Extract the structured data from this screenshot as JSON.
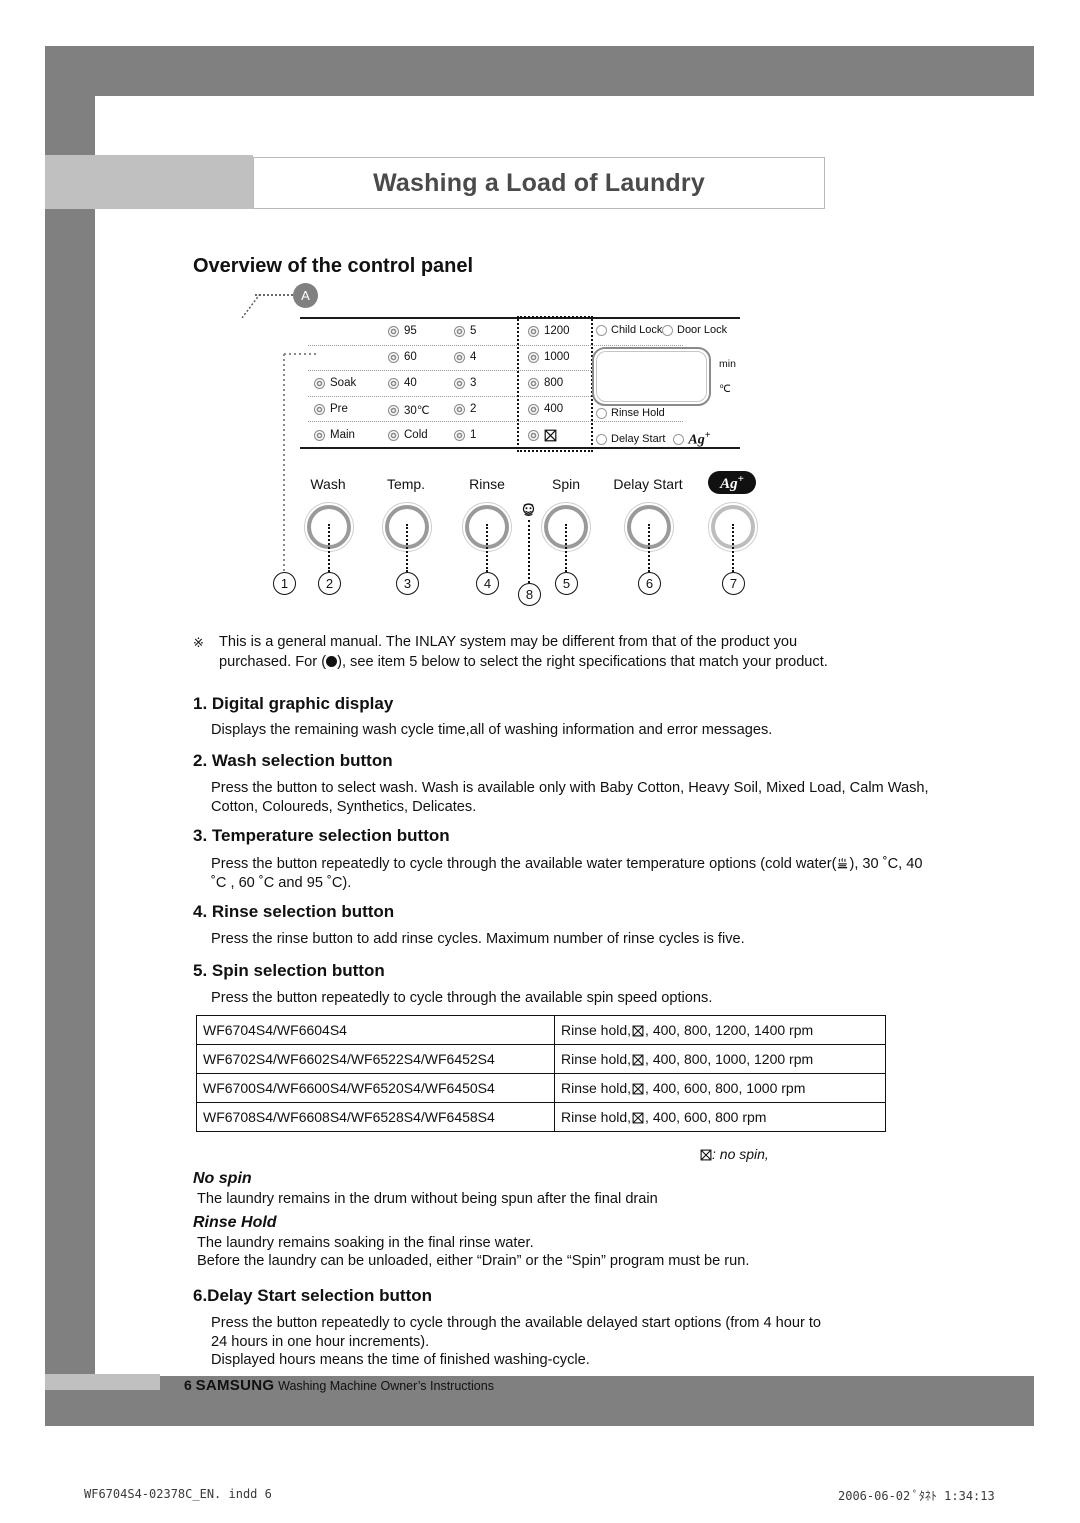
{
  "header": {
    "title": "Washing a Load of Laundry",
    "section_heading": "Overview of the control panel"
  },
  "panel": {
    "callout_label": "A",
    "columns": {
      "wash": [
        "",
        "",
        "Soak",
        "Pre",
        "Main"
      ],
      "temp": [
        "95",
        "60",
        "40",
        "30℃",
        "Cold"
      ],
      "rinse": [
        "5",
        "4",
        "3",
        "2",
        "1"
      ],
      "spin": [
        "1200",
        "1000",
        "800",
        "400",
        "no-spin-icon"
      ]
    },
    "indicators": {
      "child_lock": "Child Lock",
      "door_lock": "Door Lock",
      "rinse_hold": "Rinse Hold",
      "delay_start": "Delay Start",
      "ag_plus": "Ag",
      "ag_sup": "+"
    },
    "units": {
      "min": "min",
      "celsius": "℃"
    },
    "buttons": [
      {
        "label": "Wash",
        "number": "2"
      },
      {
        "label": "Temp.",
        "number": "3"
      },
      {
        "label": "Rinse",
        "number": "4"
      },
      {
        "label": "Spin",
        "number": "5"
      },
      {
        "label": "Delay Start",
        "number": "6"
      },
      {
        "label": "Ag",
        "number": "7"
      }
    ],
    "markers": {
      "display": "1",
      "baby": "8"
    }
  },
  "note": {
    "mark": "※",
    "line1": "This is a general manual. The INLAY system may be different from that of the product you",
    "line2_pre": "purchased. For (",
    "line2_post": "), see item 5 below to select the right specifications that match your product."
  },
  "items": [
    {
      "heading": "1. Digital graphic display",
      "body": "Displays the remaining wash cycle time,all of washing information and error messages."
    },
    {
      "heading": "2. Wash selection button",
      "body": "Press the button to select wash. Wash is available only with Baby Cotton, Heavy Soil, Mixed Load, Calm Wash, Cotton, Coloureds, Synthetics, Delicates."
    },
    {
      "heading": "3. Temperature selection button",
      "body_pre": "Press the button  repeatedly to cycle through the available water temperature options  (cold water(",
      "body_post": "), 30 ˚C, 40 ˚C , 60 ˚C and 95 ˚C)."
    },
    {
      "heading": "4. Rinse selection button",
      "body": "Press the rinse button to add rinse cycles. Maximum number of rinse cycles is five."
    },
    {
      "heading": "5. Spin selection button",
      "body": "Press the button repeatedly to cycle through the available spin speed options."
    },
    {
      "heading": "6.Delay Start selection button",
      "body_line1": "Press the button repeatedly to cycle through the available delayed start options (from 4 hour to",
      "body_line2": "24 hours in one hour increments).",
      "body_line3": "Displayed hours means the time of finished washing-cycle."
    }
  ],
  "spec_table": {
    "rows": [
      {
        "models": "WF6704S4/WF6604S4",
        "speeds_pre": "Rinse hold,",
        "speeds_post": ", 400, 800, 1200, 1400 rpm"
      },
      {
        "models": "WF6702S4/WF6602S4/WF6522S4/WF6452S4",
        "speeds_pre": "Rinse hold,",
        "speeds_post": ", 400, 800, 1000, 1200 rpm"
      },
      {
        "models": "WF6700S4/WF6600S4/WF6520S4/WF6450S4",
        "speeds_pre": "Rinse hold,",
        "speeds_post": ", 400, 600, 800, 1000 rpm"
      },
      {
        "models": "WF6708S4/WF6608S4/WF6528S4/WF6458S4",
        "speeds_pre": "Rinse hold,",
        "speeds_post": ", 400, 600, 800 rpm"
      }
    ],
    "legend_post": ": no spin,"
  },
  "definitions": [
    {
      "term": "No spin",
      "lines": [
        "The laundry remains in the drum without being spun after the final drain"
      ]
    },
    {
      "term": "Rinse Hold",
      "lines": [
        "The laundry remains soaking in the final rinse water.",
        "Before the laundry can be unloaded, either “Drain” or the “Spin” program must be run."
      ]
    }
  ],
  "footer": {
    "page": "6",
    "brand": "SAMSUNG",
    "subtitle": "Washing Machine Owner’s Instructions",
    "print_left": "WF6704S4-02378C_EN. indd   6",
    "print_right": "2006-06-02   ﾟﾀﾈﾄ 1:34:13"
  }
}
